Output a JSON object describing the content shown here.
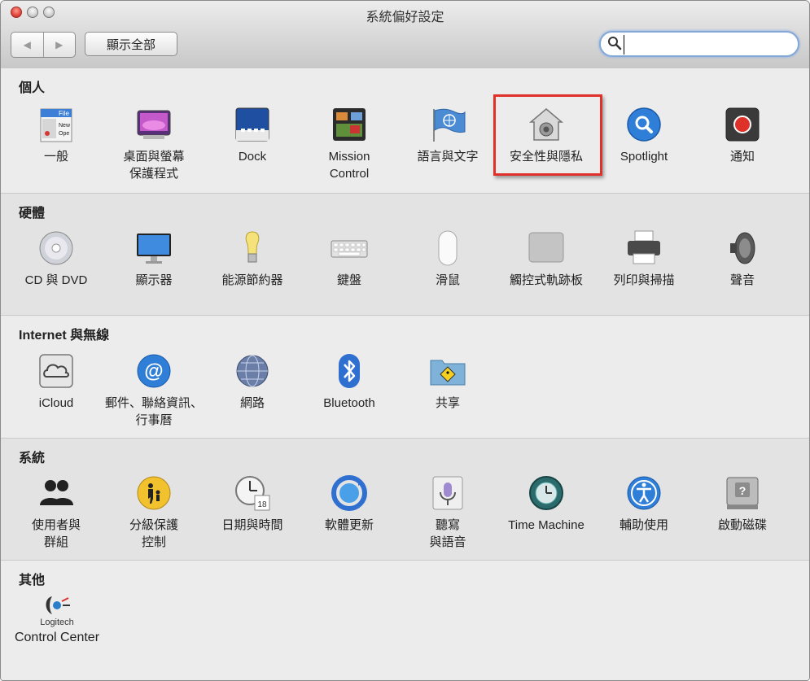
{
  "window": {
    "title": "系統偏好設定"
  },
  "toolbar": {
    "back": "◀",
    "forward": "▶",
    "show_all": "顯示全部"
  },
  "search": {
    "value": "",
    "placeholder": ""
  },
  "sections": [
    {
      "title": "個人",
      "items": [
        {
          "label": "一般",
          "icon": "general-icon"
        },
        {
          "label": "桌面與螢幕\n保護程式",
          "icon": "desktop-screensaver-icon"
        },
        {
          "label": "Dock",
          "icon": "dock-icon"
        },
        {
          "label": "Mission\nControl",
          "icon": "mission-control-icon"
        },
        {
          "label": "語言與文字",
          "icon": "language-flag-icon"
        },
        {
          "label": "安全性與隱私",
          "icon": "security-house-icon"
        },
        {
          "label": "Spotlight",
          "icon": "spotlight-icon"
        },
        {
          "label": "通知",
          "icon": "notifications-icon"
        }
      ]
    },
    {
      "title": "硬體",
      "items": [
        {
          "label": "CD 與 DVD",
          "icon": "cd-dvd-icon"
        },
        {
          "label": "顯示器",
          "icon": "display-icon"
        },
        {
          "label": "能源節約器",
          "icon": "energy-bulb-icon"
        },
        {
          "label": "鍵盤",
          "icon": "keyboard-icon"
        },
        {
          "label": "滑鼠",
          "icon": "mouse-icon"
        },
        {
          "label": "觸控式軌跡板",
          "icon": "trackpad-icon"
        },
        {
          "label": "列印與掃描",
          "icon": "printer-icon"
        },
        {
          "label": "聲音",
          "icon": "speaker-icon"
        }
      ]
    },
    {
      "title": "Internet 與無線",
      "items": [
        {
          "label": "iCloud",
          "icon": "icloud-icon"
        },
        {
          "label": "郵件、聯絡資訊、\n行事曆",
          "icon": "mail-at-icon"
        },
        {
          "label": "網路",
          "icon": "network-globe-icon"
        },
        {
          "label": "Bluetooth",
          "icon": "bluetooth-icon"
        },
        {
          "label": "共享",
          "icon": "sharing-folder-icon"
        }
      ]
    },
    {
      "title": "系統",
      "items": [
        {
          "label": "使用者與\n群組",
          "icon": "users-icon"
        },
        {
          "label": "分級保護\n控制",
          "icon": "parental-controls-icon"
        },
        {
          "label": "日期與時間",
          "icon": "clock-calendar-icon"
        },
        {
          "label": "軟體更新",
          "icon": "software-update-icon"
        },
        {
          "label": "聽寫\n與語音",
          "icon": "microphone-icon"
        },
        {
          "label": "Time Machine",
          "icon": "time-machine-icon"
        },
        {
          "label": "輔助使用",
          "icon": "accessibility-icon"
        },
        {
          "label": "啟動磁碟",
          "icon": "startup-disk-icon"
        }
      ]
    },
    {
      "title": "其他",
      "items": [
        {
          "label": "Control Center",
          "icon": "logitech-icon",
          "brand": "Logitech"
        }
      ]
    }
  ],
  "colors": {
    "highlight": "#e0302a",
    "accent_blue": "#2f7fd8"
  }
}
